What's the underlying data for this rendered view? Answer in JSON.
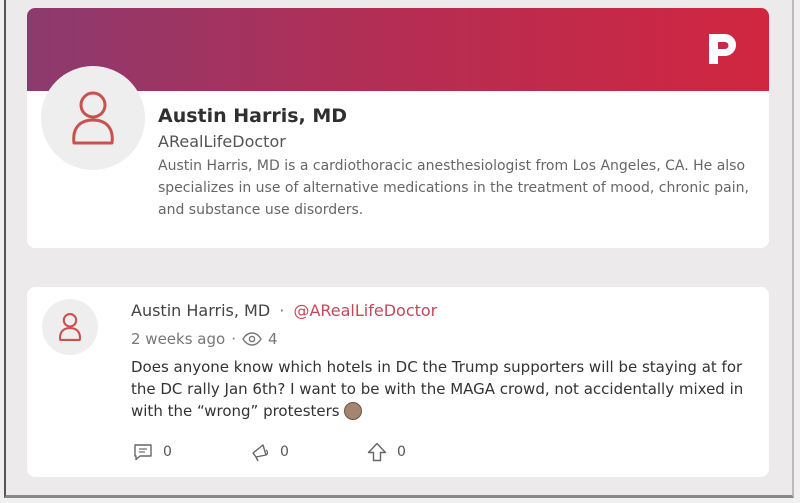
{
  "profile": {
    "display_name": "Austin Harris, MD",
    "username": "ARealLifeDoctor",
    "bio": "Austin Harris, MD is a cardiothoracic anesthesiologist from Los Angeles, CA. He also specializes in use of alternative medications in the treatment of mood, chronic pain, and substance use disorders."
  },
  "post": {
    "author": "Austin Harris, MD",
    "separator": "·",
    "mention": "@ARealLifeDoctor",
    "time_ago": "2 weeks ago",
    "meta_separator": "·",
    "view_count": "4",
    "text": "Does anyone know which hotels in DC the Trump supporters will be staying at for the DC rally Jan 6th? I want to be with the MAGA crowd, not accidentally mixed in with the “wrong” protesters",
    "emoji_icon": "slightly-smiling-face-icon",
    "actions": {
      "comments": "0",
      "echoes": "0",
      "upvotes": "0"
    }
  },
  "colors": {
    "banner_start": "#8c3a6e",
    "banner_end": "#d12640",
    "accent": "#c0495a"
  }
}
